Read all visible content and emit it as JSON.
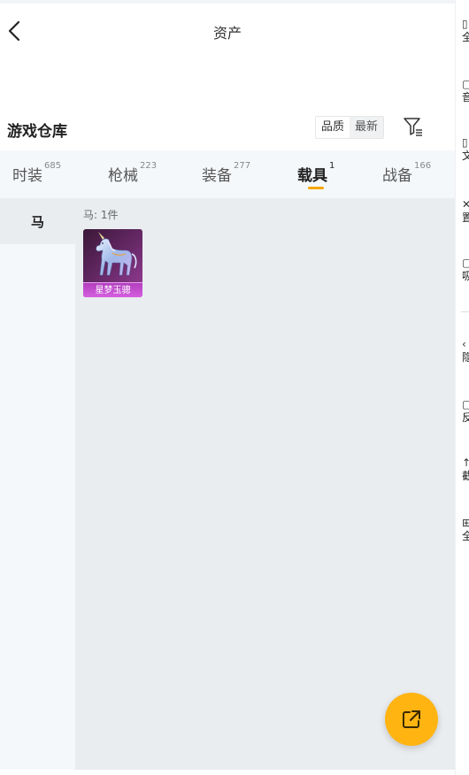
{
  "header": {
    "title": "资产"
  },
  "warehouse": {
    "title": "游戏仓库"
  },
  "sort": {
    "quality": "品质",
    "newest": "最新"
  },
  "tabs": [
    {
      "label": "时装",
      "count": "685"
    },
    {
      "label": "枪械",
      "count": "223"
    },
    {
      "label": "装备",
      "count": "277"
    },
    {
      "label": "载具",
      "count": "1"
    },
    {
      "label": "战备",
      "count": "166"
    }
  ],
  "active_tab": "载具",
  "side": {
    "items": [
      {
        "label": "马"
      }
    ]
  },
  "content": {
    "count_label": "马: 1件",
    "items": [
      {
        "name": "星梦玉骢"
      }
    ]
  },
  "right_panel": {
    "items": [
      {
        "icon": "qr-icon",
        "label": "全"
      },
      {
        "icon": "frame-icon",
        "label": "音"
      },
      {
        "icon": "doc-icon",
        "label": "文"
      },
      {
        "icon": "settings-icon",
        "label": "置"
      },
      {
        "icon": "box-icon",
        "label": "吸"
      },
      {
        "icon": "chevron-icon",
        "label": "隐"
      },
      {
        "icon": "feedback-icon",
        "label": "反"
      },
      {
        "icon": "up-icon",
        "label": "截"
      },
      {
        "icon": "grid-icon",
        "label": "全"
      }
    ]
  },
  "colors": {
    "accent": "#f7a600",
    "fab": "#ffb412",
    "item_rarity": "#c04ccc"
  }
}
